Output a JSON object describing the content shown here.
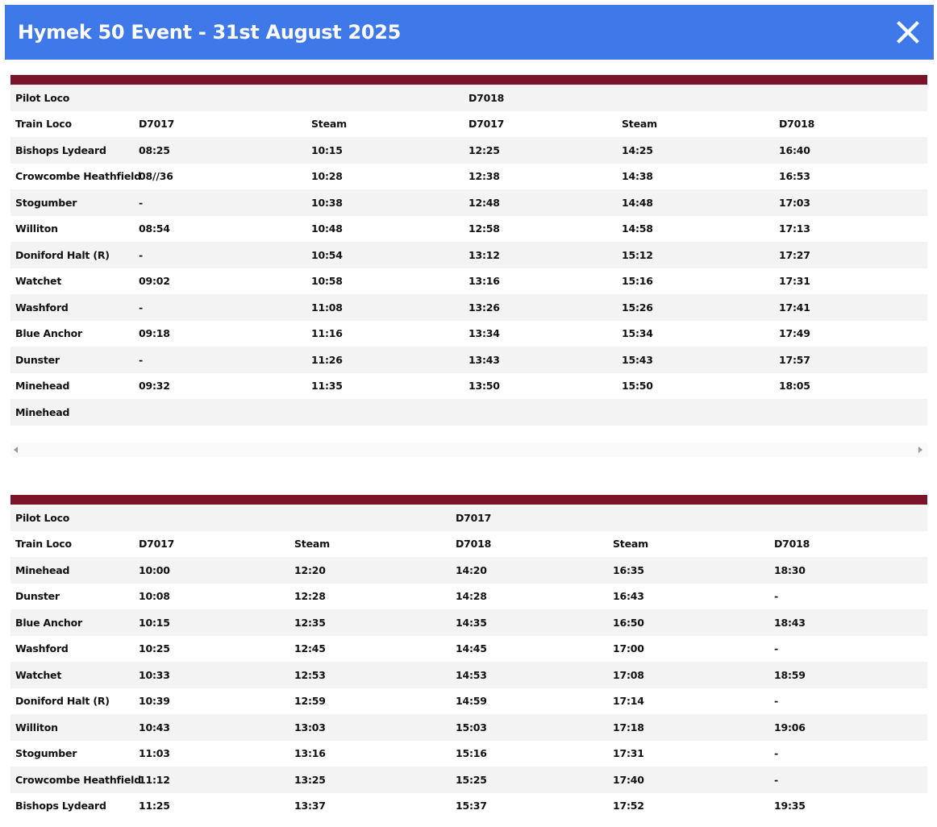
{
  "modal": {
    "title": "Hymek 50 Event - 31st August 2025",
    "close_icon": "close-icon"
  },
  "colors": {
    "header": "#3f78e8",
    "bar": "#7a1529",
    "stripe": "#f3f3f3"
  },
  "tables": [
    {
      "rows": [
        [
          "Pilot Loco",
          "",
          "",
          "D7018",
          "",
          ""
        ],
        [
          "Train Loco",
          "D7017",
          "Steam",
          "D7017",
          "Steam",
          "D7018"
        ],
        [
          "Bishops Lydeard",
          "08:25",
          "10:15",
          "12:25",
          "14:25",
          "16:40"
        ],
        [
          "Crowcombe Heathfield",
          "08//36",
          "10:28",
          "12:38",
          "14:38",
          "16:53"
        ],
        [
          "Stogumber",
          "-",
          "10:38",
          "12:48",
          "14:48",
          "17:03"
        ],
        [
          "Williton",
          "08:54",
          "10:48",
          "12:58",
          "14:58",
          "17:13"
        ],
        [
          "Doniford Halt (R)",
          "-",
          "10:54",
          "13:12",
          "15:12",
          "17:27"
        ],
        [
          "Watchet",
          "09:02",
          "10:58",
          "13:16",
          "15:16",
          "17:31"
        ],
        [
          "Washford",
          "-",
          "11:08",
          "13:26",
          "15:26",
          "17:41"
        ],
        [
          "Blue Anchor",
          "09:18",
          "11:16",
          "13:34",
          "15:34",
          "17:49"
        ],
        [
          "Dunster",
          "-",
          "11:26",
          "13:43",
          "15:43",
          "17:57"
        ],
        [
          "Minehead",
          "09:32",
          "11:35",
          "13:50",
          "15:50",
          "18:05"
        ],
        [
          "Minehead",
          "",
          "",
          "",
          "",
          ""
        ]
      ]
    },
    {
      "rows": [
        [
          "Pilot Loco",
          "",
          "",
          "D7017",
          "",
          ""
        ],
        [
          "Train Loco",
          "D7017",
          "Steam",
          "D7018",
          "Steam",
          "D7018"
        ],
        [
          "Minehead",
          "10:00",
          "12:20",
          "14:20",
          "16:35",
          "18:30"
        ],
        [
          "Dunster",
          "10:08",
          "12:28",
          "14:28",
          "16:43",
          "-"
        ],
        [
          "Blue Anchor",
          "10:15",
          "12:35",
          "14:35",
          "16:50",
          "18:43"
        ],
        [
          "Washford",
          "10:25",
          "12:45",
          "14:45",
          "17:00",
          "-"
        ],
        [
          "Watchet",
          "10:33",
          "12:53",
          "14:53",
          "17:08",
          "18:59"
        ],
        [
          "Doniford Halt (R)",
          "10:39",
          "12:59",
          "14:59",
          "17:14",
          "-"
        ],
        [
          "Williton",
          "10:43",
          "13:03",
          "15:03",
          "17:18",
          "19:06"
        ],
        [
          "Stogumber",
          "11:03",
          "13:16",
          "15:16",
          "17:31",
          "-"
        ],
        [
          "Crowcombe Heathfield",
          "11:12",
          "13:25",
          "15:25",
          "17:40",
          "-"
        ],
        [
          "Bishops Lydeard",
          "11:25",
          "13:37",
          "15:37",
          "17:52",
          "19:35"
        ]
      ]
    }
  ]
}
